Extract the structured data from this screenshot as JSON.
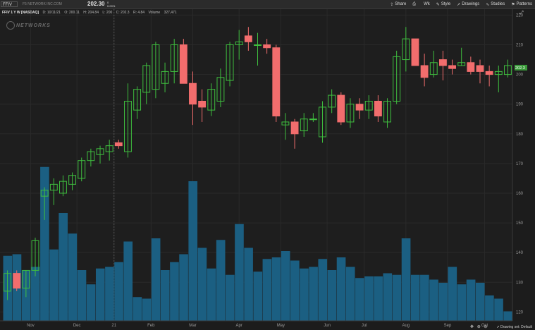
{
  "header": {
    "symbol": "FFIV",
    "company": "F5 NETWORK INC.COM",
    "last": "202.30",
    "net_change": "0",
    "pct_change": "0.00%"
  },
  "toolbar": {
    "share_label": "Share",
    "print_label": "",
    "wk_label": "Wk",
    "style_label": "Style",
    "drawings_label": "Drawings",
    "studies_label": "Studies",
    "patterns_label": "Patterns"
  },
  "chart_header": {
    "title": "FFIV 1 Y W [NASDAQ]",
    "date": "D: 10/11/21",
    "open": "O: 200.11",
    "high": "H: 204.84",
    "low": "L: 200",
    "close": "C: 202.3",
    "change": "R: 4.84",
    "volume": "Volume",
    "volume_value": "327,471"
  },
  "watermark": {
    "text": "NETWORKS"
  },
  "status_bar": {
    "drawing_set": "Drawing set: Default"
  },
  "colors": {
    "up": "#3fbf3f",
    "down": "#f26d6d",
    "volume": "#1b5f82",
    "price_tag": "#3a9a3a",
    "grid": "#2a2a2a"
  },
  "chart_data": {
    "type": "candlestick",
    "title": "",
    "xlabel": "",
    "ylabel": "",
    "ylim": [
      117,
      222
    ],
    "yticks": [
      120,
      130,
      140,
      150,
      160,
      170,
      180,
      190,
      200,
      210,
      220
    ],
    "xticks": [
      "Nov",
      "Dec",
      "21",
      "Feb",
      "Mar",
      "Apr",
      "May",
      "Jun",
      "Jul",
      "Aug",
      "Sep",
      "Oct"
    ],
    "xtick_index": [
      2.5,
      7.5,
      11.5,
      15.5,
      20,
      25,
      29.5,
      34.5,
      38.5,
      43,
      47.5,
      51.5
    ],
    "last_price_label": "202.3",
    "last_price": 202.3,
    "grid": true,
    "candles": [
      {
        "o": 127,
        "h": 134,
        "l": 124,
        "c": 133
      },
      {
        "o": 133,
        "h": 134,
        "l": 127,
        "c": 128
      },
      {
        "o": 128,
        "h": 134,
        "l": 125,
        "c": 134
      },
      {
        "o": 134,
        "h": 145,
        "l": 132,
        "c": 144
      },
      {
        "o": 159,
        "h": 162,
        "l": 151,
        "c": 161
      },
      {
        "o": 161,
        "h": 165,
        "l": 156,
        "c": 163
      },
      {
        "o": 160,
        "h": 166,
        "l": 159,
        "c": 164
      },
      {
        "o": 163,
        "h": 167,
        "l": 161,
        "c": 166
      },
      {
        "o": 165,
        "h": 172,
        "l": 164,
        "c": 171
      },
      {
        "o": 171,
        "h": 175,
        "l": 169,
        "c": 174
      },
      {
        "o": 173,
        "h": 176,
        "l": 170,
        "c": 175
      },
      {
        "o": 174,
        "h": 178,
        "l": 171,
        "c": 176
      },
      {
        "o": 177,
        "h": 178,
        "l": 175,
        "c": 176
      },
      {
        "o": 174,
        "h": 197,
        "l": 172,
        "c": 191
      },
      {
        "o": 188,
        "h": 196,
        "l": 185,
        "c": 195
      },
      {
        "o": 194,
        "h": 204,
        "l": 190,
        "c": 203
      },
      {
        "o": 195,
        "h": 211,
        "l": 192,
        "c": 210
      },
      {
        "o": 197,
        "h": 204,
        "l": 194,
        "c": 201
      },
      {
        "o": 201,
        "h": 212,
        "l": 197,
        "c": 210
      },
      {
        "o": 210,
        "h": 212,
        "l": 197,
        "c": 197
      },
      {
        "o": 197,
        "h": 201,
        "l": 183,
        "c": 190
      },
      {
        "o": 191,
        "h": 195,
        "l": 184,
        "c": 189
      },
      {
        "o": 188,
        "h": 197,
        "l": 186,
        "c": 195
      },
      {
        "o": 191,
        "h": 202,
        "l": 189,
        "c": 199
      },
      {
        "o": 198,
        "h": 211,
        "l": 196,
        "c": 210
      },
      {
        "o": 210,
        "h": 215,
        "l": 205,
        "c": 211
      },
      {
        "o": 213,
        "h": 216,
        "l": 208,
        "c": 211
      },
      {
        "o": 210,
        "h": 214,
        "l": 203,
        "c": 210
      },
      {
        "o": 210,
        "h": 212,
        "l": 207,
        "c": 209
      },
      {
        "o": 209,
        "h": 210,
        "l": 184,
        "c": 186
      },
      {
        "o": 183,
        "h": 187,
        "l": 178,
        "c": 184
      },
      {
        "o": 184,
        "h": 185,
        "l": 175,
        "c": 180
      },
      {
        "o": 181,
        "h": 187,
        "l": 179,
        "c": 185
      },
      {
        "o": 185,
        "h": 187,
        "l": 184,
        "c": 185
      },
      {
        "o": 179,
        "h": 191,
        "l": 177,
        "c": 189
      },
      {
        "o": 189,
        "h": 195,
        "l": 187,
        "c": 193
      },
      {
        "o": 193,
        "h": 194,
        "l": 183,
        "c": 184
      },
      {
        "o": 184,
        "h": 192,
        "l": 182,
        "c": 190
      },
      {
        "o": 190,
        "h": 192,
        "l": 185,
        "c": 188
      },
      {
        "o": 188,
        "h": 193,
        "l": 185,
        "c": 191
      },
      {
        "o": 191,
        "h": 193,
        "l": 184,
        "c": 186
      },
      {
        "o": 184,
        "h": 192,
        "l": 182,
        "c": 191
      },
      {
        "o": 191,
        "h": 208,
        "l": 190,
        "c": 206
      },
      {
        "o": 205,
        "h": 216,
        "l": 201,
        "c": 212
      },
      {
        "o": 212,
        "h": 212,
        "l": 203,
        "c": 203
      },
      {
        "o": 203,
        "h": 207,
        "l": 196,
        "c": 199
      },
      {
        "o": 200,
        "h": 208,
        "l": 199,
        "c": 204
      },
      {
        "o": 205,
        "h": 208,
        "l": 198,
        "c": 203
      },
      {
        "o": 203,
        "h": 205,
        "l": 200,
        "c": 202
      },
      {
        "o": 203,
        "h": 209,
        "l": 203,
        "c": 204
      },
      {
        "o": 204,
        "h": 206,
        "l": 200,
        "c": 201
      },
      {
        "o": 203,
        "h": 205,
        "l": 197,
        "c": 201
      },
      {
        "o": 201,
        "h": 203,
        "l": 196,
        "c": 200
      },
      {
        "o": 200,
        "h": 203,
        "l": 194,
        "c": 201
      },
      {
        "o": 200,
        "h": 205,
        "l": 199,
        "c": 203
      }
    ],
    "volume_series": {
      "name": "Volume",
      "values": [
        0.41,
        0.42,
        0.32,
        0.34,
        0.97,
        0.45,
        0.68,
        0.55,
        0.32,
        0.23,
        0.33,
        0.34,
        0.37,
        0.5,
        0.15,
        0.14,
        0.52,
        0.32,
        0.37,
        0.42,
        0.88,
        0.46,
        0.33,
        0.51,
        0.29,
        0.61,
        0.46,
        0.31,
        0.39,
        0.4,
        0.44,
        0.38,
        0.33,
        0.34,
        0.39,
        0.32,
        0.4,
        0.34,
        0.27,
        0.28,
        0.28,
        0.3,
        0.29,
        0.52,
        0.29,
        0.29,
        0.26,
        0.24,
        0.34,
        0.23,
        0.26,
        0.24,
        0.16,
        0.14,
        0.06
      ]
    }
  }
}
